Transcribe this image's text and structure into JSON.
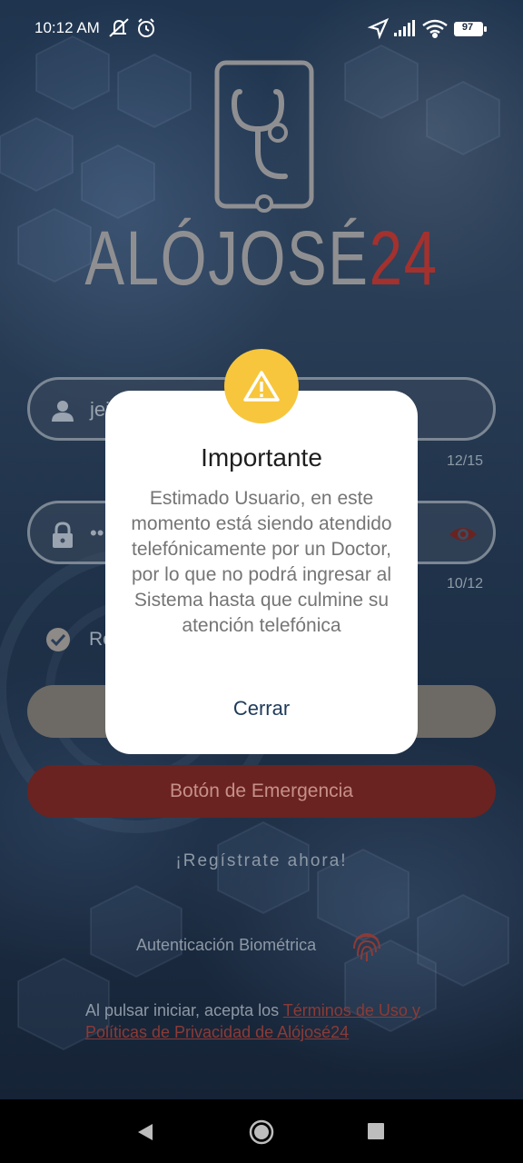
{
  "status_bar": {
    "time": "10:12 AM",
    "battery": "97"
  },
  "brand": {
    "name_main": "ALÓJOSÉ",
    "name_accent": "24",
    "accent_color": "#a3312e"
  },
  "login_form": {
    "username_value": "jei",
    "username_counter": "12/15",
    "password_value": "••",
    "password_counter": "10/12",
    "remember_label": "Re",
    "emergency_label": "Botón de Emergencia",
    "register_link": "¡Regístrate ahora!",
    "biometric_label": "Autenticación Biométrica",
    "terms_prefix": "Al pulsar iniciar, acepta los ",
    "terms_link": "Términos de Uso y Políticas de Privacidad de Alójosé24"
  },
  "dialog": {
    "title": "Importante",
    "message": "Estimado Usuario, en este momento está siendo atendido telefónicamente por un Doctor, por lo que no podrá ingresar al Sistema hasta que culmine su atención telefónica",
    "close_label": "Cerrar",
    "badge_color": "#f7c63c",
    "icon": "warning-icon"
  },
  "icons": {
    "user": "user-icon",
    "lock": "lock-icon",
    "eye": "eye-icon",
    "check": "check-icon",
    "fingerprint": "fingerprint-icon",
    "stethoscope": "stethoscope-phone-logo"
  }
}
